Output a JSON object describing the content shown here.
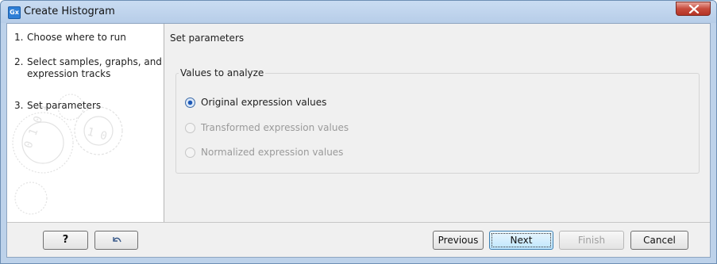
{
  "window": {
    "title": "Create Histogram",
    "icon_text": "Gx"
  },
  "steps": [
    {
      "num": "1.",
      "label": "Choose where to run"
    },
    {
      "num": "2.",
      "label": "Select samples, graphs, and expression tracks"
    },
    {
      "num": "3.",
      "label": "Set parameters"
    }
  ],
  "main": {
    "section_title": "Set parameters",
    "group_title": "Values to analyze",
    "options": [
      {
        "label": "Original expression values",
        "selected": true,
        "enabled": true
      },
      {
        "label": "Transformed expression values",
        "selected": false,
        "enabled": false
      },
      {
        "label": "Normalized expression values",
        "selected": false,
        "enabled": false
      }
    ]
  },
  "buttons": {
    "help": "?",
    "previous": "Previous",
    "next": "Next",
    "finish": "Finish",
    "cancel": "Cancel"
  },
  "icons": {
    "help_icon": "question-mark",
    "reset_icon": "undo-arrow-icon",
    "close_icon": "close-x-icon"
  },
  "colors": {
    "accent": "#3c7fb1",
    "close": "#c74b3c",
    "frame": "#bdd2ea"
  }
}
